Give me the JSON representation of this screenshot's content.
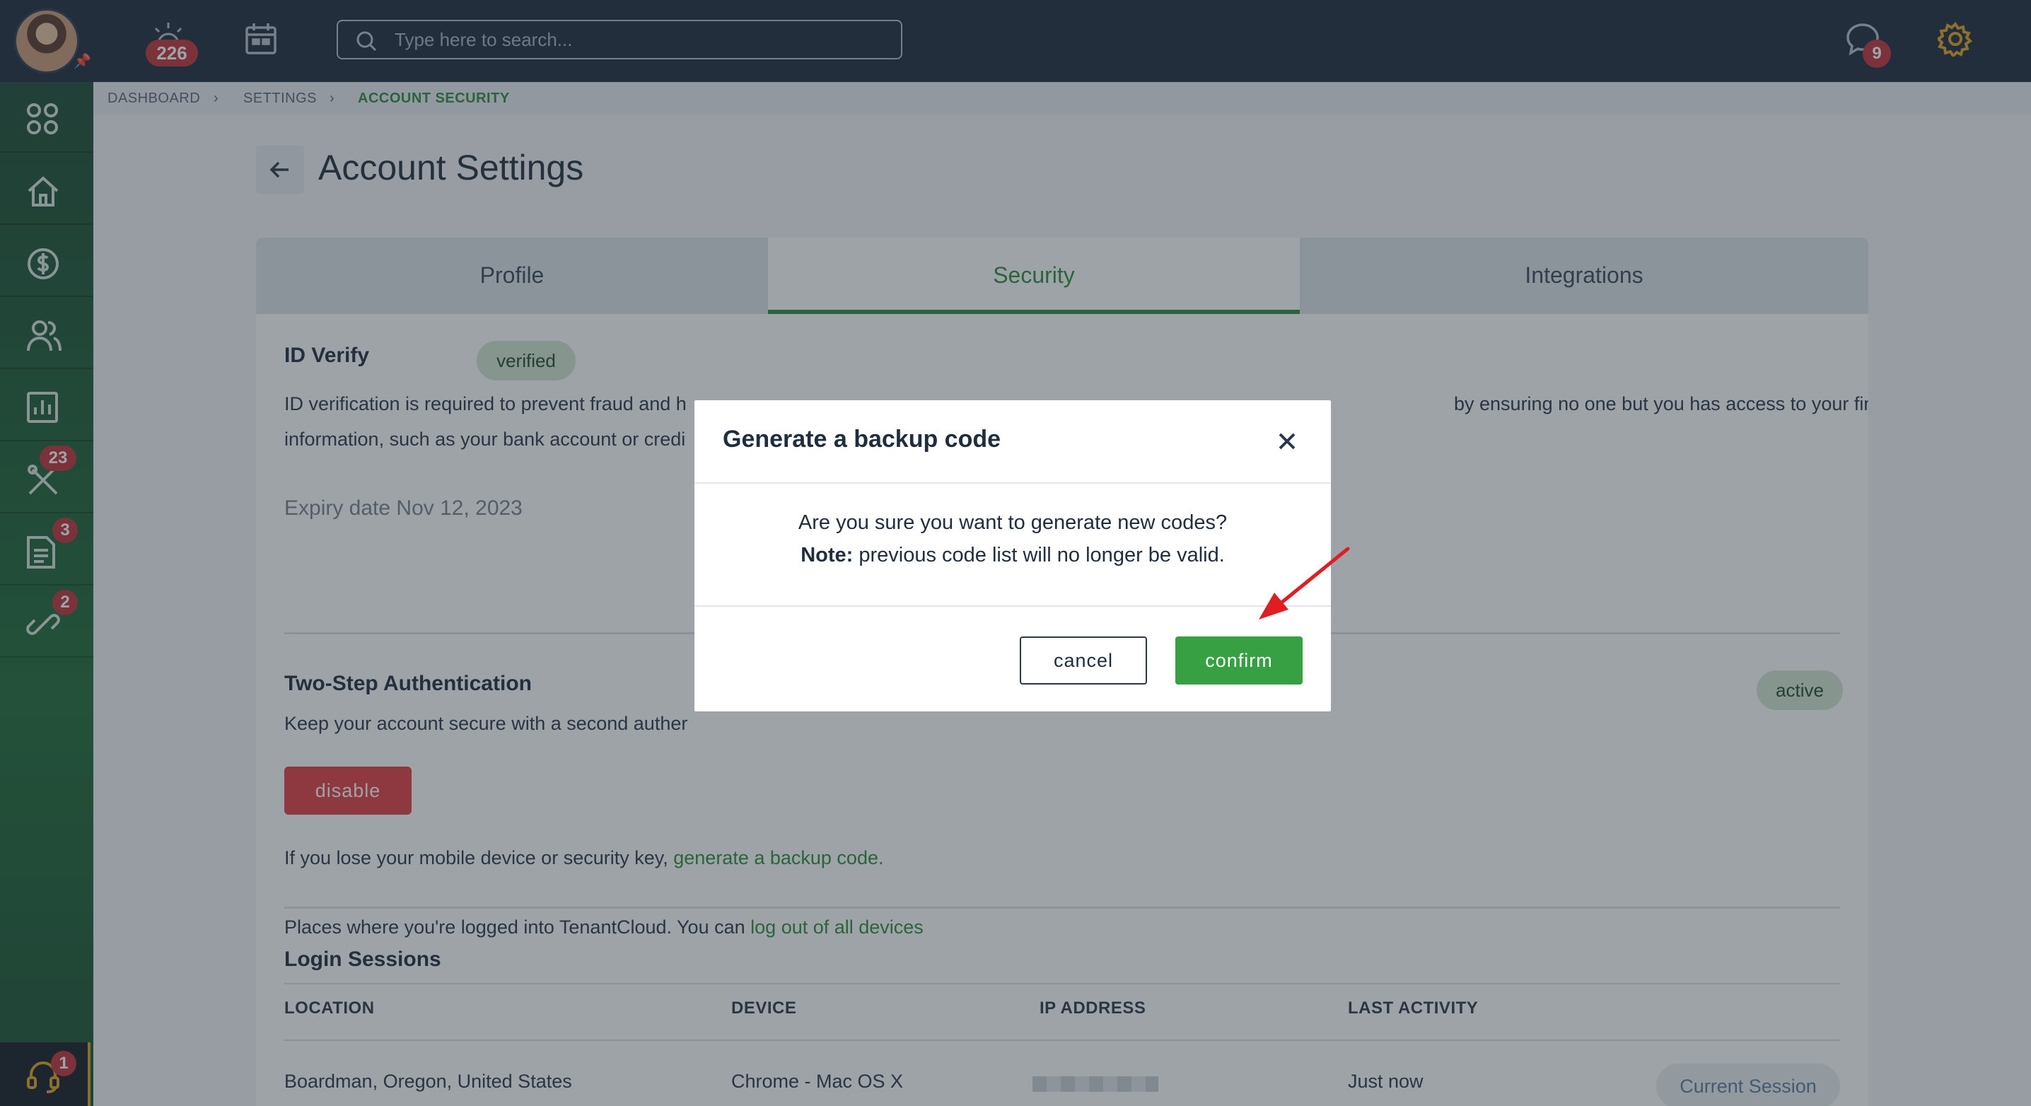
{
  "topbar": {
    "notifications_count": "226",
    "search_placeholder": "Type here to search...",
    "messages_count": "9"
  },
  "sidebar": {
    "badges": {
      "tools": "23",
      "documents": "3",
      "links": "2",
      "support": "1"
    }
  },
  "breadcrumb": [
    "DASHBOARD",
    "SETTINGS",
    "ACCOUNT SECURITY"
  ],
  "page": {
    "title": "Account Settings"
  },
  "tabs": [
    {
      "label": "Profile"
    },
    {
      "label": "Security"
    },
    {
      "label": "Integrations"
    }
  ],
  "id_verify": {
    "title": "ID Verify",
    "status": "verified",
    "desc_line1_start": "ID verification is required to prevent fraud and h",
    "desc_line1_end": "by ensuring no one but you has access to your financial",
    "desc_line2": "information, such as your bank account or credi",
    "expiry": "Expiry date Nov 12, 2023"
  },
  "two_step": {
    "title": "Two-Step Authentication",
    "status": "active",
    "desc": "Keep your account secure with a second auther",
    "disable_label": "disable",
    "backup_text": "If you lose your mobile device or security key,",
    "backup_link": "generate a backup code."
  },
  "login_sessions": {
    "title": "Login Sessions",
    "desc": "Places where you're logged into TenantCloud. You can",
    "logout_link": "log out of all devices",
    "columns": [
      "LOCATION",
      "DEVICE",
      "IP ADDRESS",
      "LAST ACTIVITY"
    ],
    "rows": [
      {
        "location": "Boardman, Oregon, United States",
        "device": "Chrome - Mac OS X",
        "last_activity": "Just now",
        "tag": "Current Session"
      }
    ]
  },
  "modal": {
    "title": "Generate a backup code",
    "question": "Are you sure you want to generate new codes?",
    "note_label": "Note:",
    "note_text": "previous code list will no longer be valid.",
    "cancel_label": "cancel",
    "confirm_label": "confirm"
  },
  "colors": {
    "topbar": "#1e2b3b",
    "sidebar": "#1f6b38",
    "accent_green": "#2e8b3c",
    "confirm_green": "#36a043",
    "disable_red": "#e03e43",
    "badge_red": "#c0323a",
    "arrow_red": "#e11d24"
  }
}
